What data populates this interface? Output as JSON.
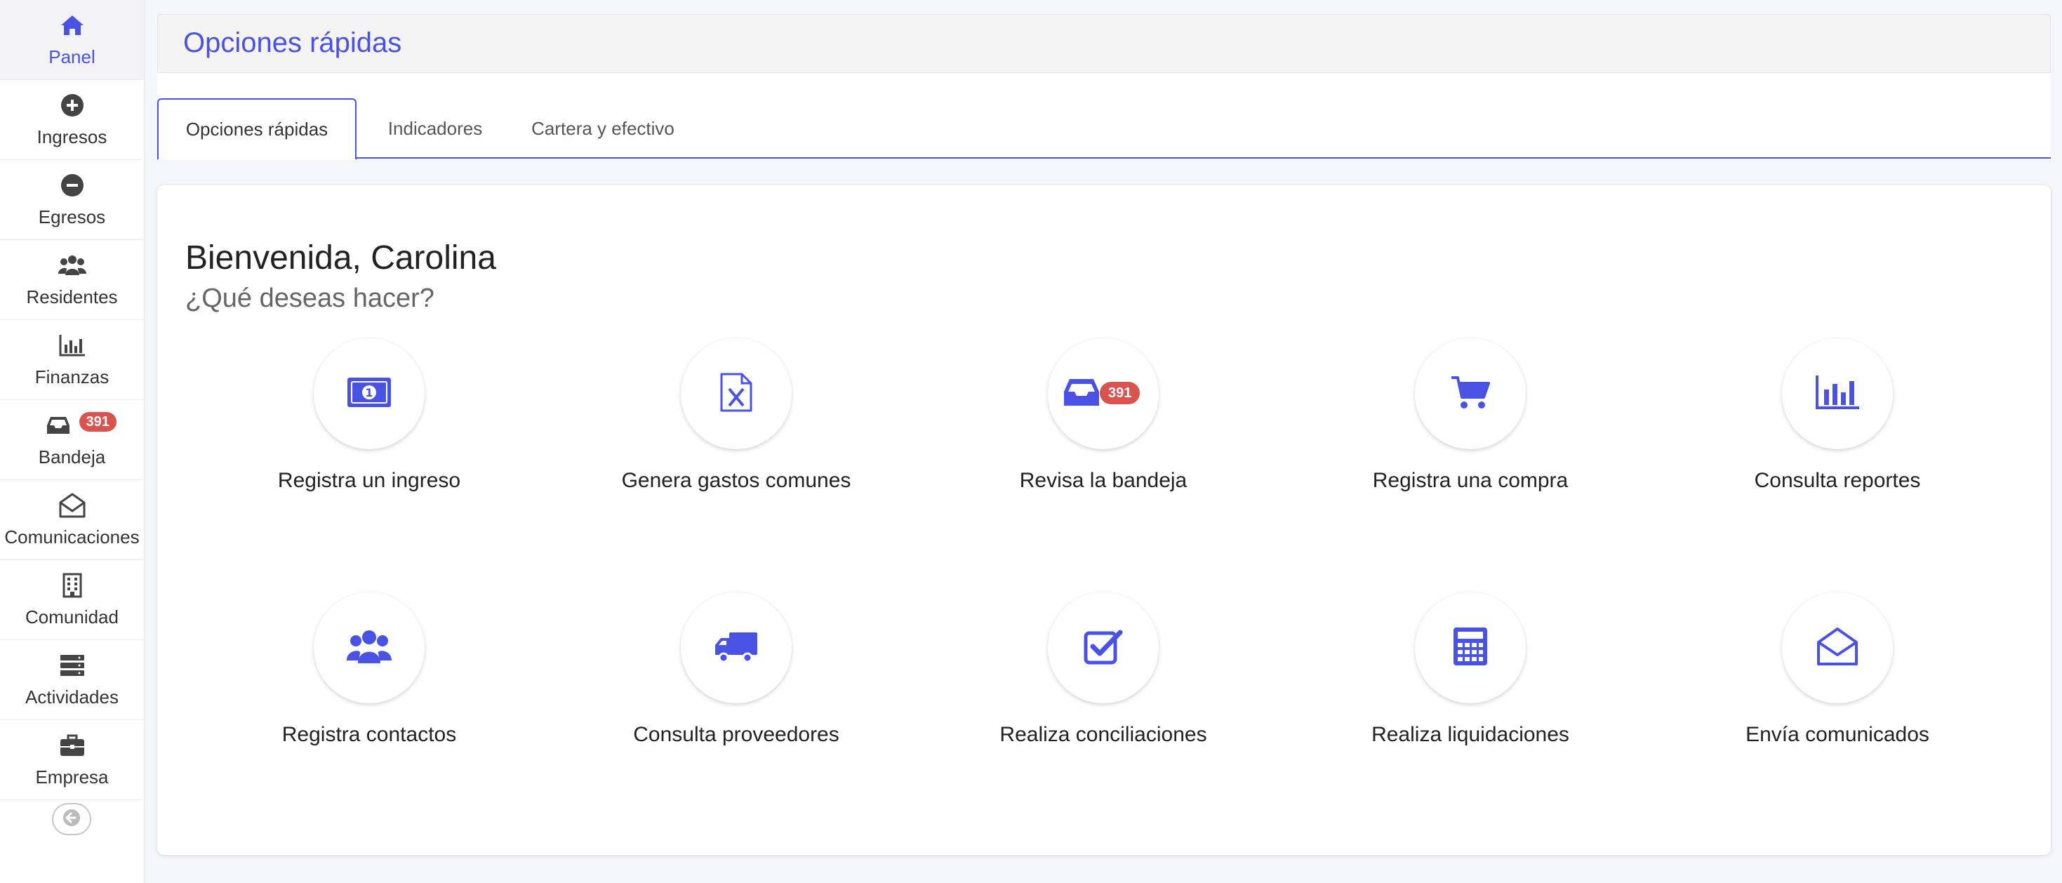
{
  "sidebar": {
    "items": [
      {
        "label": "Panel",
        "icon": "home-icon"
      },
      {
        "label": "Ingresos",
        "icon": "plus-circle-icon"
      },
      {
        "label": "Egresos",
        "icon": "minus-circle-icon"
      },
      {
        "label": "Residentes",
        "icon": "users-icon"
      },
      {
        "label": "Finanzas",
        "icon": "bar-chart-icon"
      },
      {
        "label": "Bandeja",
        "icon": "inbox-icon",
        "badge": "391"
      },
      {
        "label": "Comunicaciones",
        "icon": "envelope-open-icon"
      },
      {
        "label": "Comunidad",
        "icon": "building-icon"
      },
      {
        "label": "Actividades",
        "icon": "server-icon"
      },
      {
        "label": "Empresa",
        "icon": "briefcase-icon"
      }
    ],
    "collapse_icon": "arrow-left-icon"
  },
  "header": {
    "title": "Opciones rápidas"
  },
  "tabs": [
    {
      "label": "Opciones rápidas",
      "active": true
    },
    {
      "label": "Indicadores"
    },
    {
      "label": "Cartera y efectivo"
    }
  ],
  "main": {
    "welcome": "Bienvenida, Carolina",
    "question": "¿Qué deseas hacer?",
    "actions": [
      {
        "label": "Registra un ingreso",
        "icon": "money-bill-icon"
      },
      {
        "label": "Genera gastos comunes",
        "icon": "excel-file-icon"
      },
      {
        "label": "Revisa la bandeja",
        "icon": "inbox-icon",
        "badge": "391"
      },
      {
        "label": "Registra una compra",
        "icon": "shopping-cart-icon"
      },
      {
        "label": "Consulta reportes",
        "icon": "bar-chart-icon"
      },
      {
        "label": "Registra contactos",
        "icon": "users-icon"
      },
      {
        "label": "Consulta proveedores",
        "icon": "truck-icon"
      },
      {
        "label": "Realiza conciliaciones",
        "icon": "check-square-icon"
      },
      {
        "label": "Realiza liquidaciones",
        "icon": "calculator-icon"
      },
      {
        "label": "Envía comunicados",
        "icon": "envelope-open-icon"
      }
    ]
  },
  "colors": {
    "accent": "#4a52e4",
    "badge": "#d9534f",
    "sidebar_icon": "#444444"
  }
}
